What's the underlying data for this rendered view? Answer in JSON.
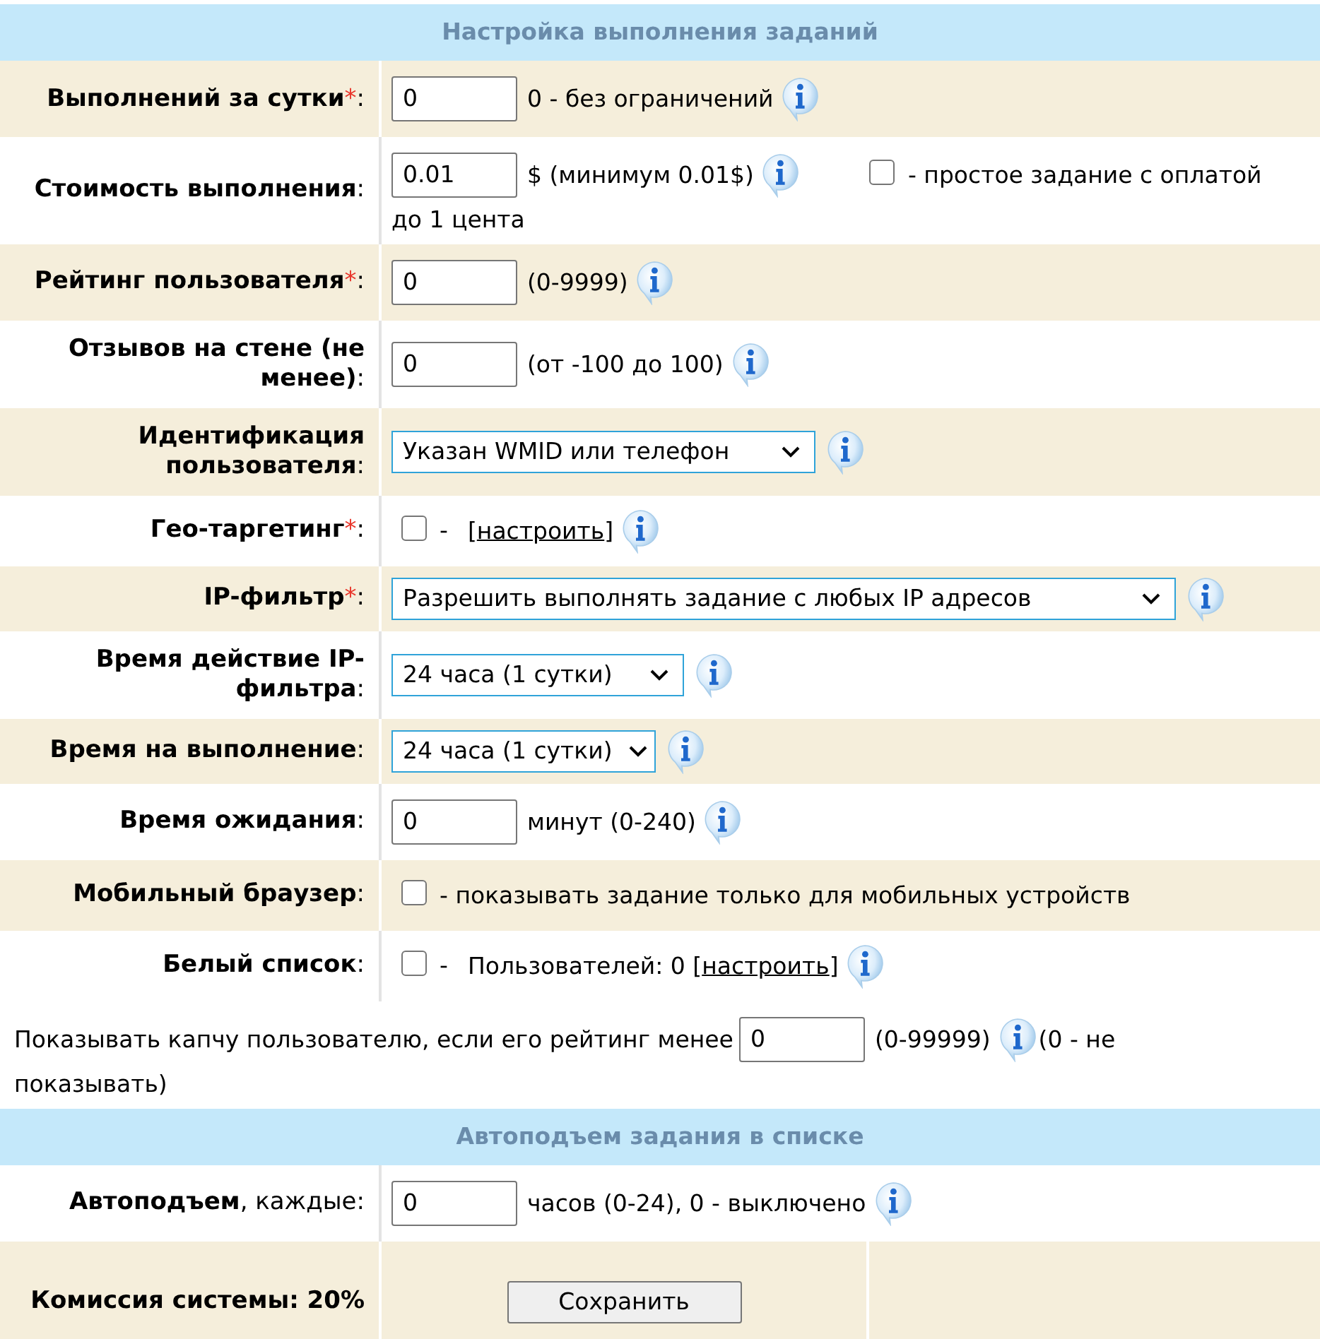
{
  "sections": [
    {
      "title": "Настройка выполнения заданий",
      "rows": [
        {
          "kind": "field",
          "shaded": true,
          "label": "**Выполнений за сутки**",
          "required_mark": "*",
          "colon": ":",
          "controls": [
            {
              "kind": "input",
              "value": "0"
            },
            {
              "kind": "text",
              "text": "0 - без ограничений"
            },
            {
              "kind": "info"
            }
          ]
        },
        {
          "kind": "field",
          "shaded": false,
          "label": "**Стоимость выполнения**",
          "colon": ":",
          "controls": [
            {
              "kind": "input",
              "value": "0.01"
            },
            {
              "kind": "text",
              "text": "$ (минимум 0.01$)"
            },
            {
              "kind": "info"
            },
            {
              "kind": "checkbox",
              "checked": false
            },
            {
              "kind": "text",
              "text": "- простое задание с оплатой"
            }
          ],
          "continuation": "до 1 цента"
        },
        {
          "kind": "field",
          "shaded": true,
          "label": "**Рейтинг пользователя**",
          "required_mark": "*",
          "colon": ":",
          "controls": [
            {
              "kind": "input",
              "value": "0"
            },
            {
              "kind": "text",
              "text": "(0-9999)"
            },
            {
              "kind": "info"
            }
          ]
        },
        {
          "kind": "field",
          "shaded": false,
          "label": "**Отзывов на стене (не менее)**",
          "colon": ":",
          "controls": [
            {
              "kind": "input",
              "value": "0"
            },
            {
              "kind": "text",
              "text": "(от -100 до 100)"
            },
            {
              "kind": "info"
            }
          ]
        },
        {
          "kind": "field",
          "shaded": true,
          "label": "**Идентификация пользователя**",
          "colon": ":",
          "controls": [
            {
              "kind": "select",
              "value": "Указан WMID или телефон"
            },
            {
              "kind": "info"
            }
          ]
        },
        {
          "kind": "field",
          "shaded": false,
          "label": "**Гео-таргетинг**",
          "required_mark": "*",
          "colon": ":",
          "controls": [
            {
              "kind": "checkbox",
              "checked": false
            },
            {
              "kind": "text",
              "text": "-"
            },
            {
              "kind": "link",
              "before": "[",
              "text": "настроить",
              "after": "]"
            },
            {
              "kind": "info"
            }
          ]
        },
        {
          "kind": "field",
          "shaded": true,
          "label": "**IP-фильтр**",
          "required_mark": "*",
          "colon": ":",
          "controls": [
            {
              "kind": "select",
              "value": "Разрешить выполнять задание с любых IP адресов"
            },
            {
              "kind": "info"
            }
          ]
        },
        {
          "kind": "field",
          "shaded": false,
          "label": "**Время действие IP-фильтра**",
          "colon": ":",
          "controls": [
            {
              "kind": "select",
              "value": "24 часа (1 сутки)"
            },
            {
              "kind": "info"
            }
          ]
        },
        {
          "kind": "field",
          "shaded": true,
          "label": "**Время на выполнение**",
          "colon": ":",
          "controls": [
            {
              "kind": "select",
              "value": "24 часа (1 сутки)"
            },
            {
              "kind": "info"
            }
          ]
        },
        {
          "kind": "field",
          "shaded": false,
          "label": "**Время ожидания**",
          "colon": ":",
          "controls": [
            {
              "kind": "input",
              "value": "0"
            },
            {
              "kind": "text",
              "text": "минут (0-240)"
            },
            {
              "kind": "info"
            }
          ]
        },
        {
          "kind": "field",
          "shaded": true,
          "label": "**Мобильный браузер**",
          "colon": ":",
          "controls": [
            {
              "kind": "checkbox",
              "checked": false
            },
            {
              "kind": "text",
              "text": "- показывать задание только для мобильных устройств"
            }
          ]
        },
        {
          "kind": "field",
          "shaded": false,
          "label": "**Белый список**",
          "colon": ":",
          "controls": [
            {
              "kind": "checkbox",
              "checked": false
            },
            {
              "kind": "text",
              "text": "-"
            },
            {
              "kind": "link",
              "before": "Пользователей: 0 [",
              "text": "настроить",
              "after": "]"
            },
            {
              "kind": "info"
            }
          ]
        },
        {
          "kind": "wide",
          "shaded": false,
          "controls": [
            {
              "kind": "text",
              "text": "Показывать капчу пользователю, если его рейтинг менее"
            },
            {
              "kind": "input",
              "value": "0"
            },
            {
              "kind": "text",
              "text": "(0-99999)"
            },
            {
              "kind": "info"
            },
            {
              "kind": "text",
              "text": "(0 - не"
            }
          ],
          "continuation": "показывать)"
        }
      ]
    },
    {
      "title": "Автоподъем задания в списке",
      "rows": [
        {
          "kind": "field",
          "shaded": false,
          "label": "**Автоподъем**, каждые",
          "colon": ":",
          "controls": [
            {
              "kind": "input",
              "value": "0"
            },
            {
              "kind": "text",
              "text": "часов (0-24), 0 - выключено"
            },
            {
              "kind": "info"
            }
          ]
        },
        {
          "kind": "submit",
          "shaded": true,
          "label": "Комиссия системы: 20%",
          "button": "Сохранить"
        }
      ]
    }
  ]
}
